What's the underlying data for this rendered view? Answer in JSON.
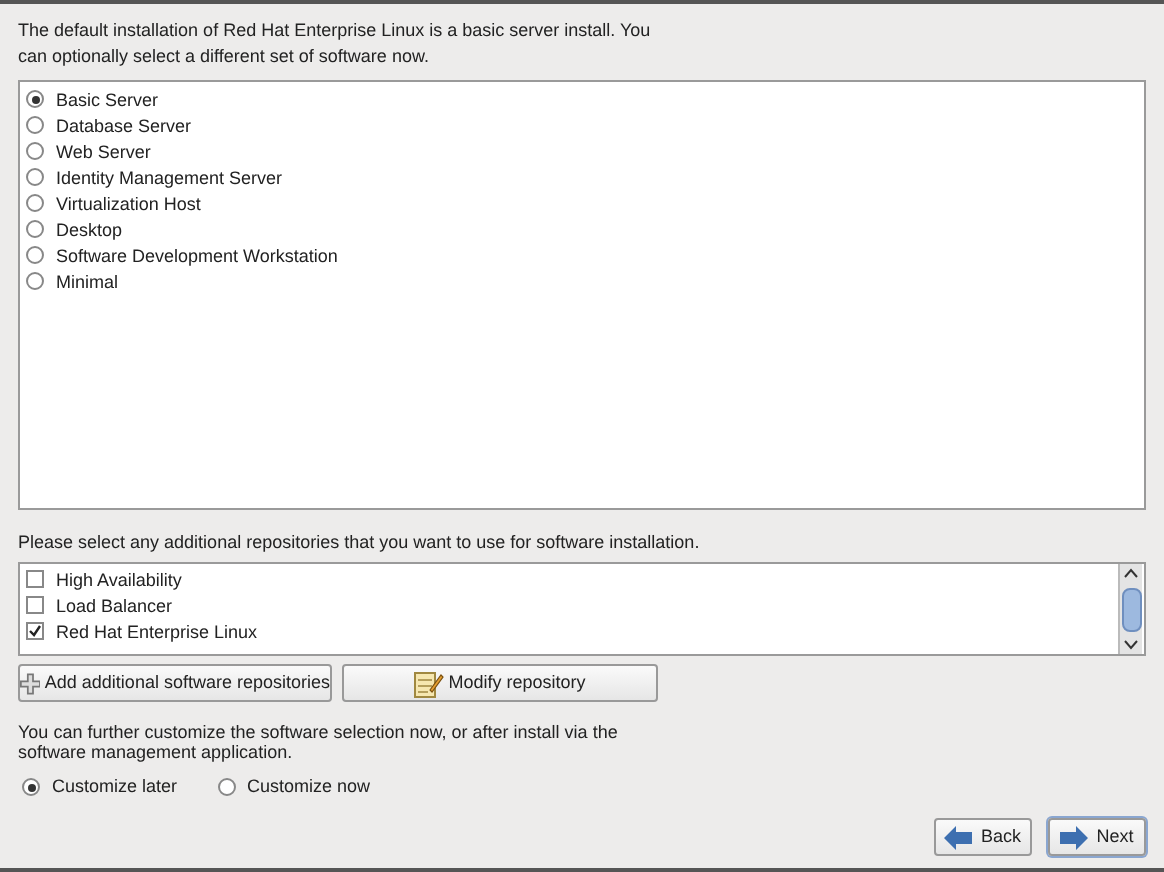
{
  "intro": "The default installation of Red Hat Enterprise Linux is a basic server install. You can optionally select a different set of software now.",
  "profiles": [
    {
      "label": "Basic Server",
      "selected": true
    },
    {
      "label": "Database Server",
      "selected": false
    },
    {
      "label": "Web Server",
      "selected": false
    },
    {
      "label": "Identity Management Server",
      "selected": false
    },
    {
      "label": "Virtualization Host",
      "selected": false
    },
    {
      "label": "Desktop",
      "selected": false
    },
    {
      "label": "Software Development Workstation",
      "selected": false
    },
    {
      "label": "Minimal",
      "selected": false
    }
  ],
  "repositories_label": "Please select any additional repositories that you want to use for software installation.",
  "repositories": [
    {
      "label": "High Availability",
      "checked": false
    },
    {
      "label": "Load Balancer",
      "checked": false
    },
    {
      "label": "Red Hat Enterprise Linux",
      "checked": true
    }
  ],
  "repo_buttons": [
    {
      "label": "Add additional software repositories"
    },
    {
      "label": "Modify repository"
    }
  ],
  "customize_text": "You can further customize the software selection now, or after install via the software management application.",
  "customize_options": [
    {
      "label": "Customize later",
      "selected": true
    },
    {
      "label": "Customize now",
      "selected": false
    }
  ],
  "nav_buttons": [
    {
      "label": "Back"
    },
    {
      "label": "Next"
    }
  ]
}
